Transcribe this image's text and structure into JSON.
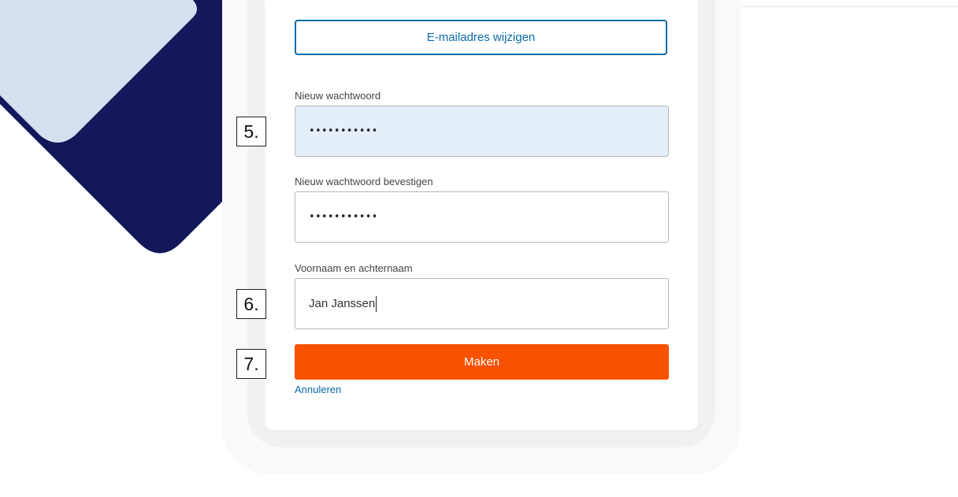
{
  "form": {
    "change_email_button": "E-mailadres wijzigen",
    "new_password": {
      "label": "Nieuw wachtwoord",
      "value": "•••••••••••"
    },
    "confirm_password": {
      "label": "Nieuw wachtwoord bevestigen",
      "value": "•••••••••••"
    },
    "full_name": {
      "label": "Voornaam en achternaam",
      "value": "Jan Janssen"
    },
    "create_button": "Maken",
    "cancel_link": "Annuleren"
  },
  "steps": [
    "5.",
    "6.",
    "7."
  ],
  "colors": {
    "primary": "#f85100",
    "link": "#0a6ba9",
    "navy_shape": "#14185a",
    "light_shape": "#d5dff0",
    "purple_shape": "#4a11a8",
    "active_field": "#e4effa"
  }
}
